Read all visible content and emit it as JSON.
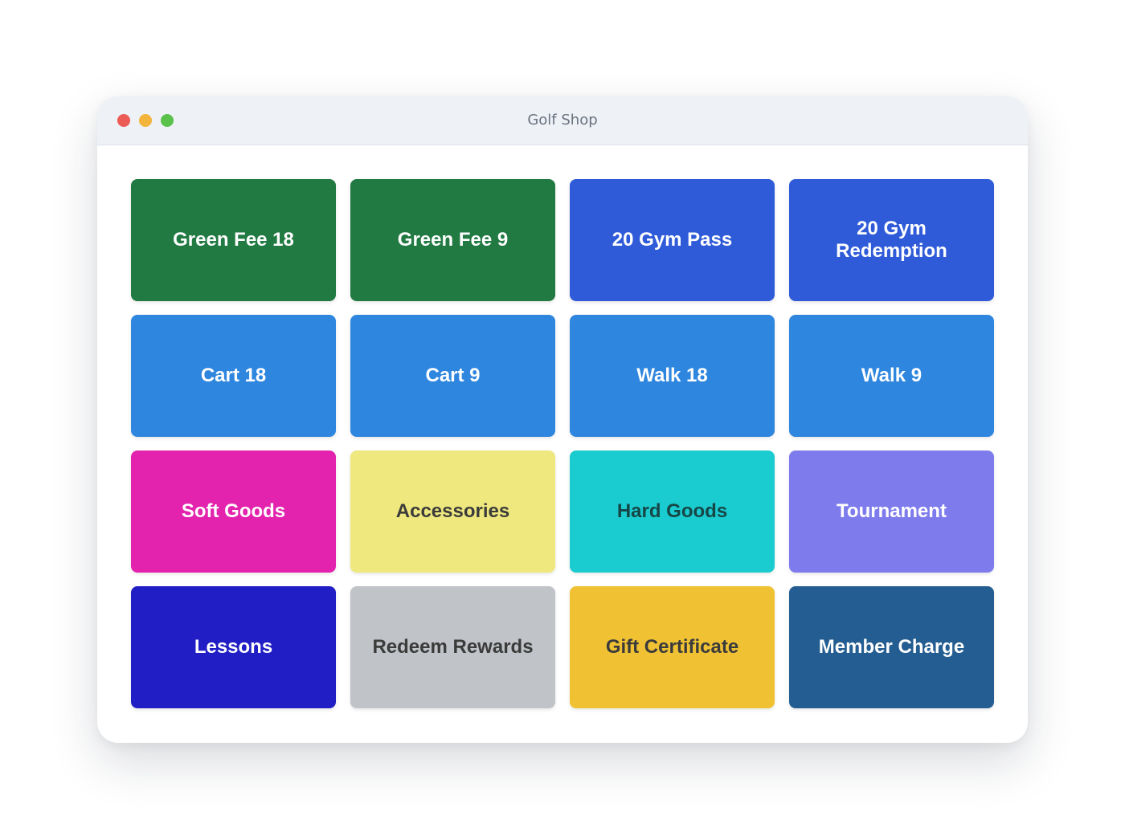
{
  "window": {
    "title": "Golf Shop",
    "controls": [
      {
        "name": "close-button",
        "color": "#ec5b55"
      },
      {
        "name": "minimize-button",
        "color": "#f2b43a"
      },
      {
        "name": "zoom-button",
        "color": "#5ac24a"
      }
    ]
  },
  "tiles": [
    {
      "label": "Green Fee 18",
      "bg": "#217a42",
      "fg": "#ffffff"
    },
    {
      "label": "Green Fee 9",
      "bg": "#217a42",
      "fg": "#ffffff"
    },
    {
      "label": "20 Gym Pass",
      "bg": "#2f5bd9",
      "fg": "#ffffff"
    },
    {
      "label": "20 Gym Redemption",
      "bg": "#2f5bd9",
      "fg": "#ffffff"
    },
    {
      "label": "Cart 18",
      "bg": "#2e86df",
      "fg": "#ffffff"
    },
    {
      "label": "Cart 9",
      "bg": "#2e86df",
      "fg": "#ffffff"
    },
    {
      "label": "Walk 18",
      "bg": "#2e86df",
      "fg": "#ffffff"
    },
    {
      "label": "Walk 9",
      "bg": "#2e86df",
      "fg": "#ffffff"
    },
    {
      "label": "Soft Goods",
      "bg": "#e322ad",
      "fg": "#ffffff"
    },
    {
      "label": "Accessories",
      "bg": "#eee87e",
      "fg": "#3b3b3b"
    },
    {
      "label": "Hard Goods",
      "bg": "#1acbcf",
      "fg": "#174647"
    },
    {
      "label": "Tournament",
      "bg": "#7e7cec",
      "fg": "#ffffff"
    },
    {
      "label": "Lessons",
      "bg": "#201ec4",
      "fg": "#ffffff"
    },
    {
      "label": "Redeem Rewards",
      "bg": "#c0c3c7",
      "fg": "#3b3b3b"
    },
    {
      "label": "Gift Certificate",
      "bg": "#f0c233",
      "fg": "#3b3b3b"
    },
    {
      "label": "Member Charge",
      "bg": "#245d91",
      "fg": "#ffffff"
    }
  ]
}
